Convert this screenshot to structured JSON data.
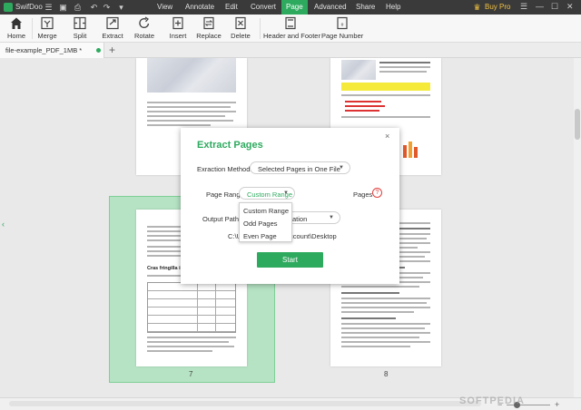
{
  "app": {
    "name": "SwifDoo",
    "buy_label": "Buy Pro"
  },
  "menu": {
    "items": [
      "View",
      "Annotate",
      "Edit",
      "Convert",
      "Page",
      "Advanced",
      "Share",
      "Help"
    ],
    "active": "Page"
  },
  "ribbon": {
    "home": "Home",
    "merge": "Merge",
    "split": "Split",
    "extract": "Extract",
    "rotate": "Rotate",
    "insert": "Insert",
    "replace": "Replace",
    "delete": "Delete",
    "header_footer": "Header and Footer",
    "page_number": "Page Number"
  },
  "tabs": [
    {
      "label": "file-example_PDF_1MB *"
    }
  ],
  "pages": [
    {
      "number": "7"
    },
    {
      "number": "8"
    }
  ],
  "page_text": {
    "create_heading": "Cras fringilla ipsum"
  },
  "dialog": {
    "title": "Extract Pages",
    "close_label": "×",
    "methods_label": "Exraction Methods:",
    "methods_value": "Selected Pages in One File",
    "range_label": "Page Range",
    "range_value": "Custom Range",
    "pages_label": "Pages",
    "help_icon_label": "?",
    "output_label": "Output Path:",
    "output_value_suffix": "ation",
    "path_prefix": "C:\\U",
    "path_suffix": "ccount\\Desktop",
    "start_label": "Start",
    "range_options": [
      "Custom Range",
      "Odd Pages",
      "Even Page"
    ]
  },
  "icons": {
    "home": "home-icon",
    "merge": "merge-icon",
    "split": "split-icon",
    "extract": "extract-icon",
    "rotate": "rotate-icon",
    "insert": "insert-icon",
    "replace": "replace-icon",
    "delete": "delete-icon",
    "header_footer": "header-footer-icon",
    "page_number": "page-number-icon"
  },
  "colors": {
    "accent": "#2eaa5f",
    "menubar": "#3a3a3a",
    "selection": "#b5e3c3",
    "help": "#e04040"
  }
}
